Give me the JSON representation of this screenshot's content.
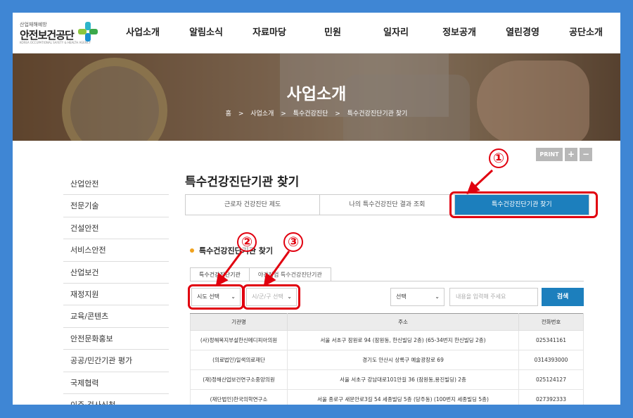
{
  "header": {
    "logo_small": "산업재해예방",
    "logo_main": "안전보건공단",
    "logo_sub": "KOREA OCCUPATIONAL SAFETY & HEALTH AGENCY",
    "nav": [
      "사업소개",
      "알림소식",
      "자료마당",
      "민원",
      "일자리",
      "정보공개",
      "열린경영",
      "공단소개"
    ]
  },
  "hero": {
    "title": "사업소개",
    "breadcrumb": [
      "홈",
      "사업소개",
      "특수건강진단",
      "특수건강진단기관 찾기"
    ],
    "breadcrumb_sep": ">"
  },
  "util": {
    "print": "PRINT",
    "zoom_in": "+",
    "zoom_out": "−"
  },
  "sidebar": {
    "items": [
      "산업안전",
      "전문기술",
      "건설안전",
      "서비스안전",
      "산업보건",
      "재정지원",
      "교육/콘텐츠",
      "안전문화홍보",
      "공공/민간기관 평가",
      "국제협력",
      "이주·검사신청"
    ]
  },
  "main": {
    "page_title": "특수건강진단기관 찾기",
    "tabs": [
      "근로자 건강진단 제도",
      "나의 특수건강진단 결과 조회",
      "특수건강진단기관 찾기"
    ],
    "section_title": "특수건강진단기관 찾기",
    "subtabs": [
      "특수건강진단기관",
      "야간작업 특수건강진단기관"
    ],
    "filters": {
      "sido": "시도 선택",
      "sigungu": "시/군/구 선택",
      "type": "선택",
      "keyword_placeholder": "내용을 입력해 주세요",
      "search_label": "검색"
    },
    "table": {
      "headers": [
        "기관명",
        "주소",
        "전화번호"
      ],
      "rows": [
        [
          "(사)정해복지부설한신메디피아의원",
          "서울 서초구 잠원로 94 (잠원동, 한신빌딩 2층) (65-34번지 한신빌딩 2층)",
          "025341161"
        ],
        [
          "(의료법인)일색의료재단",
          "경기도 안산시 상록구 예술광장로 69",
          "0314393000"
        ],
        [
          "(재)정해산업보건연구소중앙의원",
          "서울 서초구 강남대로101안길 36 (잠원동,용진빌딩) 2층",
          "025124127"
        ],
        [
          "(재단법인)한국의학연구소",
          "서울 종로구 새문안로3길 54 세종빌딩 5층 (당주동) (100번지 세종빌딩 5층)",
          "027392333"
        ]
      ]
    }
  },
  "annotations": {
    "one": "①",
    "two": "②",
    "three": "③",
    "color": "#e1000f"
  },
  "colors": {
    "accent": "#1c7fbd",
    "background": "#3f86d4",
    "dot": "#f0a21e"
  }
}
